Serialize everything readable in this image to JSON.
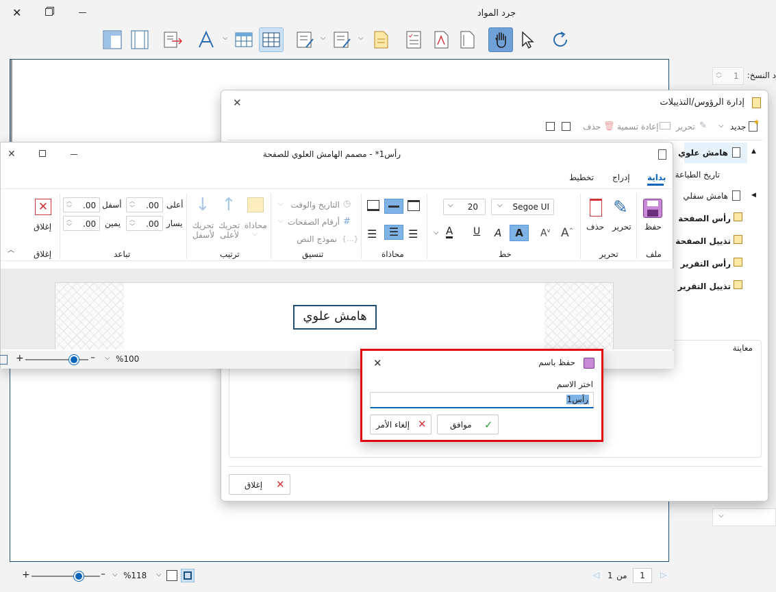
{
  "main_window": {
    "title": "جرد المواد",
    "copies_label": "د النسخ:",
    "copies_value": "1",
    "status": {
      "zoom": "%118",
      "page_current": "1",
      "page_of": "من",
      "page_total": "1"
    }
  },
  "hf_manager": {
    "title": "إدارة الرؤوس/التذييلات",
    "toolbar": {
      "new": "جديد",
      "edit": "تحرير",
      "rename": "إعادة تسمية",
      "delete": "حذف"
    },
    "tree": [
      {
        "label": "هامش علوي",
        "selected": true
      },
      {
        "label": "تاريخ الطباعة"
      },
      {
        "label": "هامش سفلي"
      },
      {
        "label": "رأس الصفحة"
      },
      {
        "label": "تذييل الصفحة"
      },
      {
        "label": "رأس التقرير"
      },
      {
        "label": "تذييل التقرير"
      }
    ],
    "preview_label": "معاينة",
    "close_label": "إغلاق"
  },
  "designer": {
    "title": "رأس1* - مصمم الهامش العلوي للصفحة",
    "tabs": [
      "بداية",
      "إدراج",
      "تخطيط"
    ],
    "groups": {
      "file": {
        "label": "ملف",
        "save": "حفظ"
      },
      "edit": {
        "label": "تحرير",
        "edit": "تحرير",
        "delete": "حذف"
      },
      "font": {
        "label": "خط",
        "family": "Segoe UI",
        "size": "20"
      },
      "align": {
        "label": "محاذاة"
      },
      "format": {
        "label": "تنسيق",
        "datetime": "التاريخ والوقت",
        "page_numbers": "أرقام الصفحات",
        "text_template": "نموذج النص"
      },
      "arrange": {
        "label": "ترتيب",
        "align": "محاذاة",
        "move_up_1": "تحريك",
        "move_up_2": "لأعلى",
        "move_down_1": "تحريك",
        "move_down_2": "لأسفل"
      },
      "spacing": {
        "label": "تباعد",
        "top": "أعلى",
        "bottom": "أسفل",
        "right": "يمين",
        "left": "يسار",
        "top_val": ".00",
        "bottom_val": ".00",
        "right_val": ".00",
        "left_val": ".00"
      },
      "close": {
        "label": "إغلاق",
        "close": "إغلاق"
      }
    },
    "canvas_text": "هامش علوي",
    "zoom": "%100"
  },
  "save_dialog": {
    "title": "حفظ باسم",
    "prompt": "اختر الاسم",
    "value": "رأس1",
    "ok": "موافق",
    "cancel": "إلغاء الأمر"
  },
  "colors": {
    "accent": "#0a64ba",
    "highlight": "#e3000f",
    "selected": "#cce0f4"
  }
}
